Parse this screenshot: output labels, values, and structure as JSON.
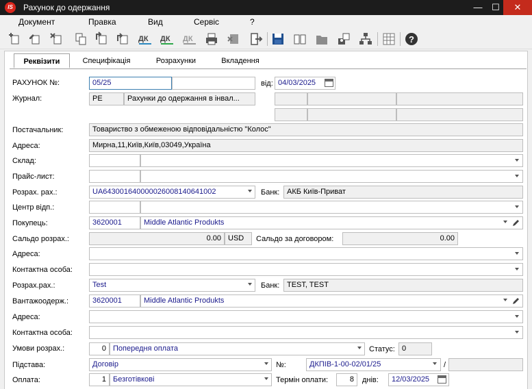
{
  "window": {
    "title": "Рахунок до одержання",
    "logo": "IS",
    "minimize": "—",
    "maximize": "☐",
    "close": "✕"
  },
  "menu": {
    "items": [
      "Документ",
      "Правка",
      "Вид",
      "Сервіс",
      "?"
    ]
  },
  "toolbar": {
    "icons": [
      "add-doc-icon",
      "edit-doc-icon",
      "delete-doc-icon",
      "copy-icon",
      "insert-icon",
      "insert-after-icon",
      "dk-debit-icon",
      "dk-credit-icon",
      "dk-grey-icon",
      "print-icon",
      "clear-icon",
      "exit-icon",
      "save-icon",
      "book-icon",
      "folder-icon",
      "user-card-icon",
      "hierarchy-icon",
      "grid-icon",
      "help-icon"
    ],
    "dk_label": "ДК"
  },
  "tabs": [
    "Реквізити",
    "Специфікація",
    "Розрахунки",
    "Вкладення"
  ],
  "form": {
    "invoice": {
      "label": "РАХУНОК №:",
      "number": "05/25",
      "from_label": "від:",
      "date": "04/03/2025"
    },
    "journal": {
      "label": "Журнал:",
      "code": "РЕ",
      "name": "Рахунки до одержання в інвал..."
    },
    "supplier": {
      "label": "Постачальник:",
      "value": "Товариство з обмеженою відповідальністю \"Колос\""
    },
    "supplier_address": {
      "label": "Адреса:",
      "value": "Мирна,11,Київ,Київ,03049,Україна"
    },
    "warehouse": {
      "label": "Склад:"
    },
    "price_list": {
      "label": "Прайс-лист:"
    },
    "settlement_account": {
      "label": "Розрах. рах.:",
      "value": "UA643001640000026008140641002",
      "bank_label": "Банк:",
      "bank": "АКБ Київ-Приват"
    },
    "responsibility_center": {
      "label": "Центр відп.:"
    },
    "buyer": {
      "label": "Покупець:",
      "code": "3620001",
      "name": "Middle Atlantic Produkts"
    },
    "balance": {
      "label": "Сальдо розрах.:",
      "value": "0.00",
      "currency": "USD",
      "contract_label": "Сальдо за договором:",
      "contract_value": "0.00"
    },
    "buyer_address": {
      "label": "Адреса:"
    },
    "contact": {
      "label": "Контактна особа:"
    },
    "buyer_account": {
      "label": "Розрах.рах.:",
      "value": "Test",
      "bank_label": "Банк:",
      "bank": "TEST, TEST"
    },
    "consignee": {
      "label": "Вантажоодерж.:",
      "code": "3620001",
      "name": "Middle Atlantic Produkts"
    },
    "consignee_address": {
      "label": "Адреса:"
    },
    "consignee_contact": {
      "label": "Контактна особа:"
    },
    "terms": {
      "label": "Умови розрах.:",
      "code": "0",
      "value": "Попередня оплата",
      "status_label": "Статус:",
      "status": "0"
    },
    "basis": {
      "label": "Підстава:",
      "value": "Договір",
      "no_label": "№:",
      "number": "ДКПІВ-1-00-02/01/25",
      "slash": "/"
    },
    "payment": {
      "label": "Оплата:",
      "code": "1",
      "value": "Безготівкові",
      "term_label": "Термін оплати:",
      "term_days": "8",
      "days_label": "днів:",
      "date": "12/03/2025"
    }
  }
}
